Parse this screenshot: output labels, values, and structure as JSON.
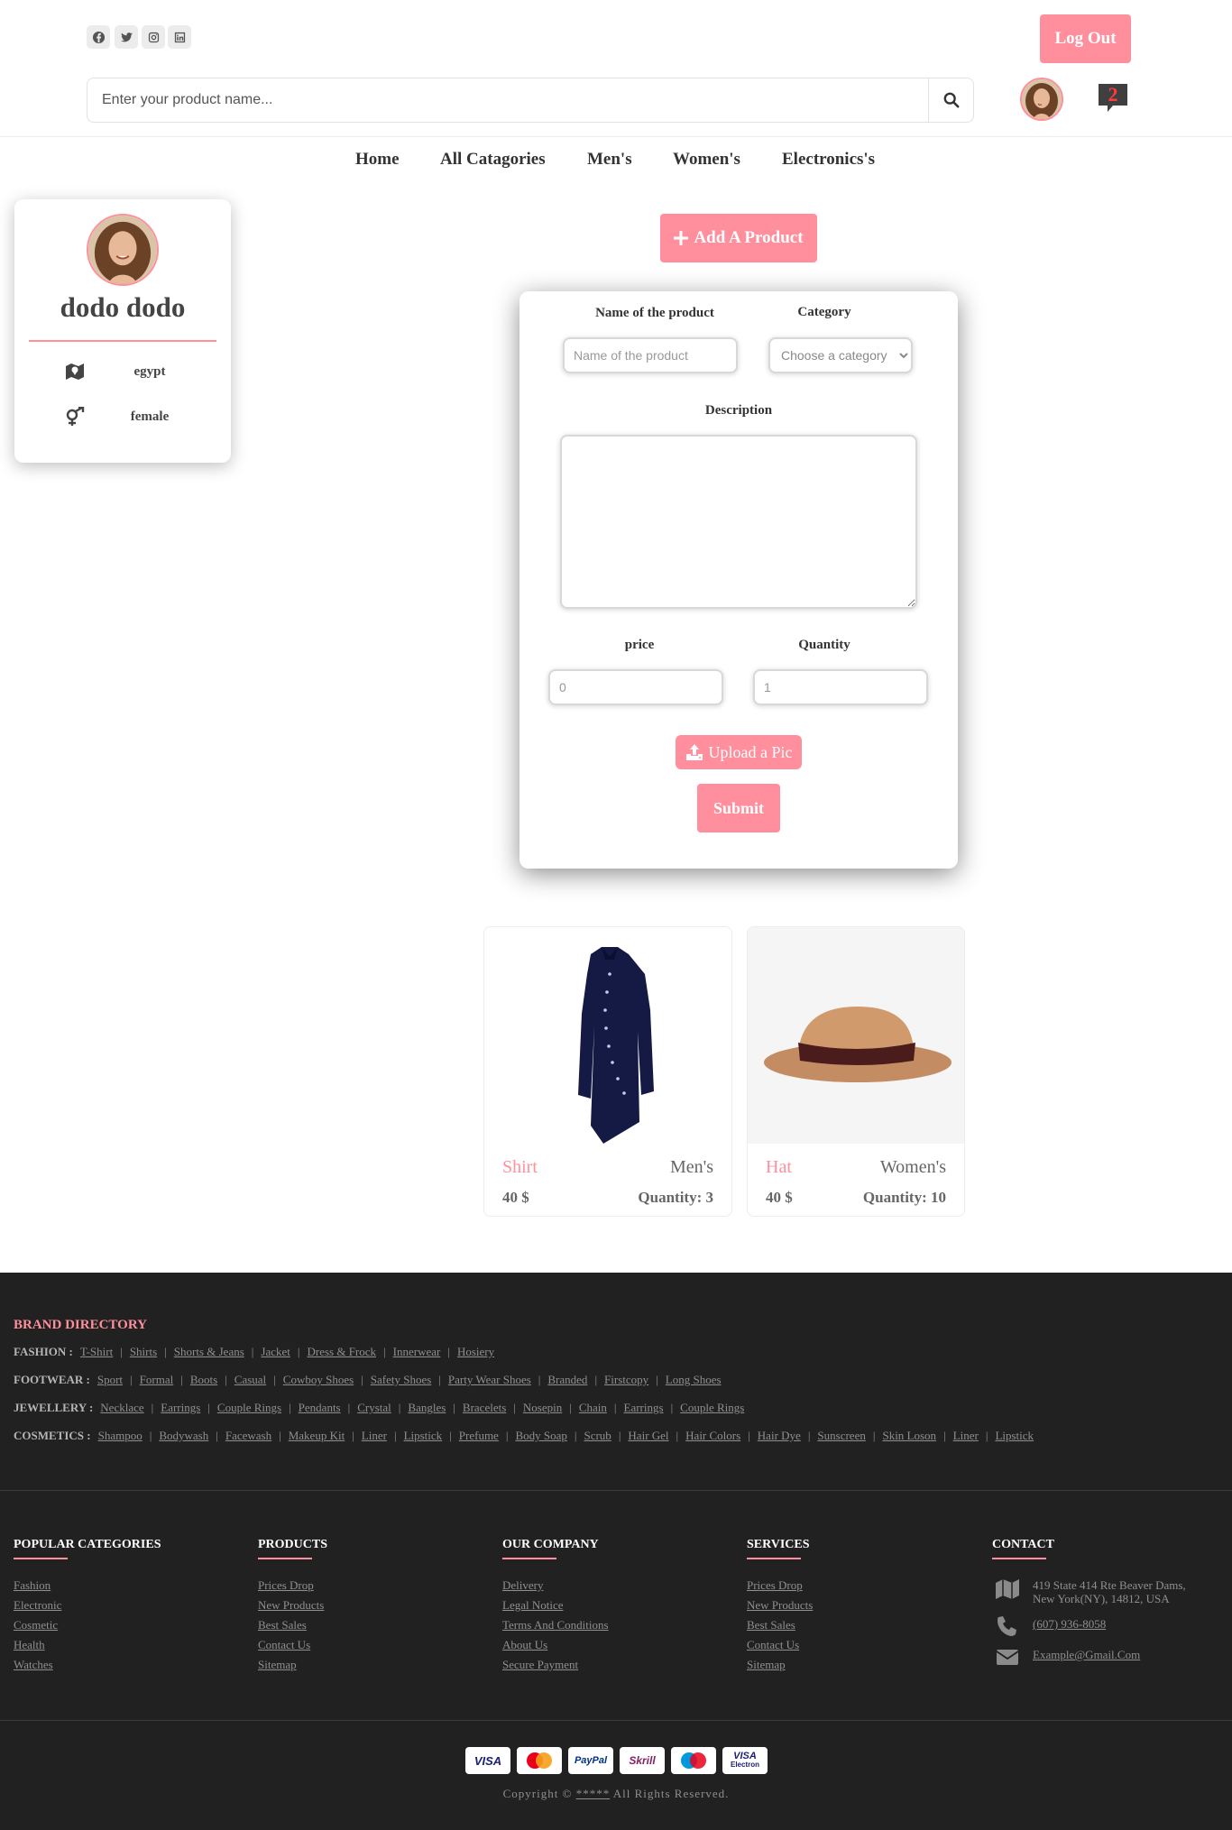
{
  "header": {
    "logout_label": "Log Out",
    "search_placeholder": "Enter your product name...",
    "message_count": "2",
    "social_icons": [
      "facebook-icon",
      "twitter-icon",
      "instagram-icon",
      "linkedin-icon"
    ]
  },
  "nav": {
    "items": [
      "Home",
      "All Catagories",
      "Men's",
      "Women's",
      "Electronics's"
    ]
  },
  "profile": {
    "name": "dodo dodo",
    "country": "egypt",
    "gender": "female"
  },
  "form": {
    "add_label": "Add A Product",
    "name_label": "Name of the product",
    "name_placeholder": "Name of the product",
    "category_label": "Category",
    "category_selected": "Choose a category",
    "description_label": "Description",
    "price_label": "price",
    "price_placeholder": "0",
    "quantity_label": "Quantity",
    "quantity_placeholder": "1",
    "upload_label": "Upload a Pic",
    "submit_label": "Submit"
  },
  "products": [
    {
      "name": "Shirt",
      "category": "Men's",
      "price": "40 $",
      "quantity": "Quantity: 3"
    },
    {
      "name": "Hat",
      "category": "Women's",
      "price": "40 $",
      "quantity": "Quantity: 10"
    }
  ],
  "brand_directory": {
    "title": "BRAND DIRECTORY",
    "rows": [
      {
        "label": "FASHION :",
        "items": [
          "T-Shirt",
          "Shirts",
          "Shorts & Jeans",
          "Jacket",
          "Dress & Frock",
          "Innerwear",
          "Hosiery"
        ]
      },
      {
        "label": "FOOTWEAR :",
        "items": [
          "Sport",
          "Formal",
          "Boots",
          "Casual",
          "Cowboy Shoes",
          "Safety Shoes",
          "Party Wear Shoes",
          "Branded",
          "Firstcopy",
          "Long Shoes"
        ]
      },
      {
        "label": "JEWELLERY :",
        "items": [
          "Necklace",
          "Earrings",
          "Couple Rings",
          "Pendants",
          "Crystal",
          "Bangles",
          "Bracelets",
          "Nosepin",
          "Chain",
          "Earrings",
          "Couple Rings"
        ]
      },
      {
        "label": "COSMETICS :",
        "items": [
          "Shampoo",
          "Bodywash",
          "Facewash",
          "Makeup Kit",
          "Liner",
          "Lipstick",
          "Prefume",
          "Body Soap",
          "Scrub",
          "Hair Gel",
          "Hair Colors",
          "Hair Dye",
          "Sunscreen",
          "Skin Loson",
          "Liner",
          "Lipstick"
        ]
      }
    ]
  },
  "footer_columns": [
    {
      "title": "POPULAR CATEGORIES",
      "links": [
        "Fashion",
        "Electronic",
        "Cosmetic",
        "Health",
        "Watches"
      ]
    },
    {
      "title": "PRODUCTS",
      "links": [
        "Prices Drop",
        "New Products",
        "Best Sales",
        "Contact Us",
        "Sitemap"
      ]
    },
    {
      "title": "OUR COMPANY",
      "links": [
        "Delivery",
        "Legal Notice",
        "Terms And Conditions",
        "About Us",
        "Secure Payment"
      ]
    },
    {
      "title": "SERVICES",
      "links": [
        "Prices Drop",
        "New Products",
        "Best Sales",
        "Contact Us",
        "Sitemap"
      ]
    }
  ],
  "contact": {
    "title": "CONTACT",
    "address_line1": "419 State 414 Rte Beaver Dams,",
    "address_line2": "New York(NY), 14812, USA",
    "phone": "(607) 936-8058",
    "email": "Example@Gmail.Com"
  },
  "payments": [
    "VISA",
    "MasterCard",
    "PayPal",
    "Skrill",
    "Maestro",
    "VISA Electron"
  ],
  "copyright": {
    "prefix": "Copyright ©",
    "link": "*****",
    "suffix": "All Rights Reserved."
  },
  "colors": {
    "accent": "#ff8f9c",
    "footer_bg": "#212121",
    "text": "#3d3d3d"
  }
}
